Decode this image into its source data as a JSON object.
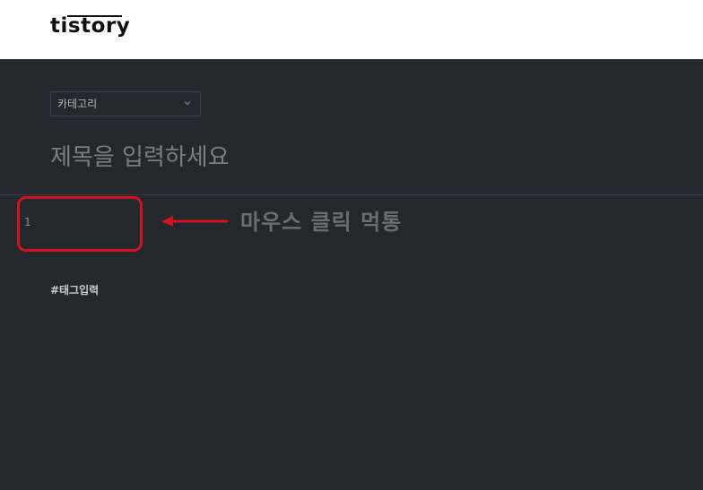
{
  "header": {
    "logo_text": "tistory"
  },
  "editor": {
    "category_label": "카테고리",
    "title_placeholder": "제목을 입력하세요",
    "line_number": "1",
    "tag_placeholder": "#태그입력"
  },
  "annotation": {
    "text": "마우스 클릭 먹통",
    "color": "#d2141a"
  },
  "icons": {
    "category_dropdown": "chevron-down-icon",
    "annotation_arrow": "left-arrow-icon"
  },
  "colors": {
    "header_bg": "#ffffff",
    "editor_bg": "#24272e",
    "highlight": "#d2141a"
  }
}
